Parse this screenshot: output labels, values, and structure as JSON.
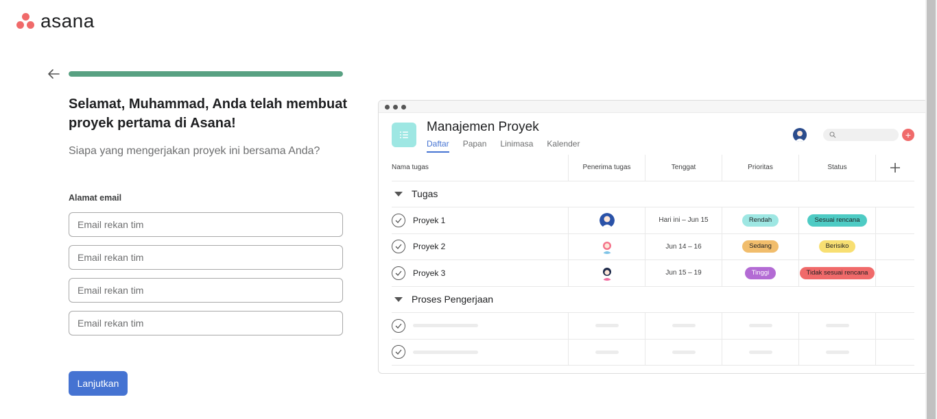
{
  "brand": {
    "name": "asana",
    "color": "#f06a6a"
  },
  "onboarding": {
    "progress": 1.0,
    "headline": "Selamat, Muhammad, Anda telah membuat proyek pertama di Asana!",
    "subheadline": "Siapa yang mengerjakan proyek ini bersama Anda?",
    "email_label": "Alamat email",
    "email_placeholder": "Email rekan tim",
    "continue_label": "Lanjutkan",
    "accent_color": "#4573d2",
    "progress_color": "#58a182"
  },
  "preview": {
    "project_title": "Manajemen Proyek",
    "tabs": [
      {
        "label": "Daftar",
        "active": true
      },
      {
        "label": "Papan",
        "active": false
      },
      {
        "label": "Linimasa",
        "active": false
      },
      {
        "label": "Kalender",
        "active": false
      }
    ],
    "columns": [
      "Nama tugas",
      "Penerima tugas",
      "Tenggat",
      "Prioritas",
      "Status"
    ],
    "sections": [
      {
        "name": "Tugas",
        "tasks": [
          {
            "name": "Proyek 1",
            "due": "Hari ini – Jun 15",
            "priority": "Rendah",
            "priority_color": "#9ee7e3",
            "status": "Sesuai rencana",
            "status_color": "#4ecbc4"
          },
          {
            "name": "Proyek 2",
            "due": "Jun 14 – 16",
            "priority": "Sedang",
            "priority_color": "#f1bd6c",
            "status": "Berisiko",
            "status_color": "#f8df72"
          },
          {
            "name": "Proyek 3",
            "due": "Jun 15 – 19",
            "priority": "Tinggi",
            "priority_color": "#b36bd4",
            "status": "Tidak sesuai rencana",
            "status_color": "#f06a6a"
          }
        ]
      },
      {
        "name": "Proses Pengerjaan",
        "tasks": []
      }
    ]
  }
}
